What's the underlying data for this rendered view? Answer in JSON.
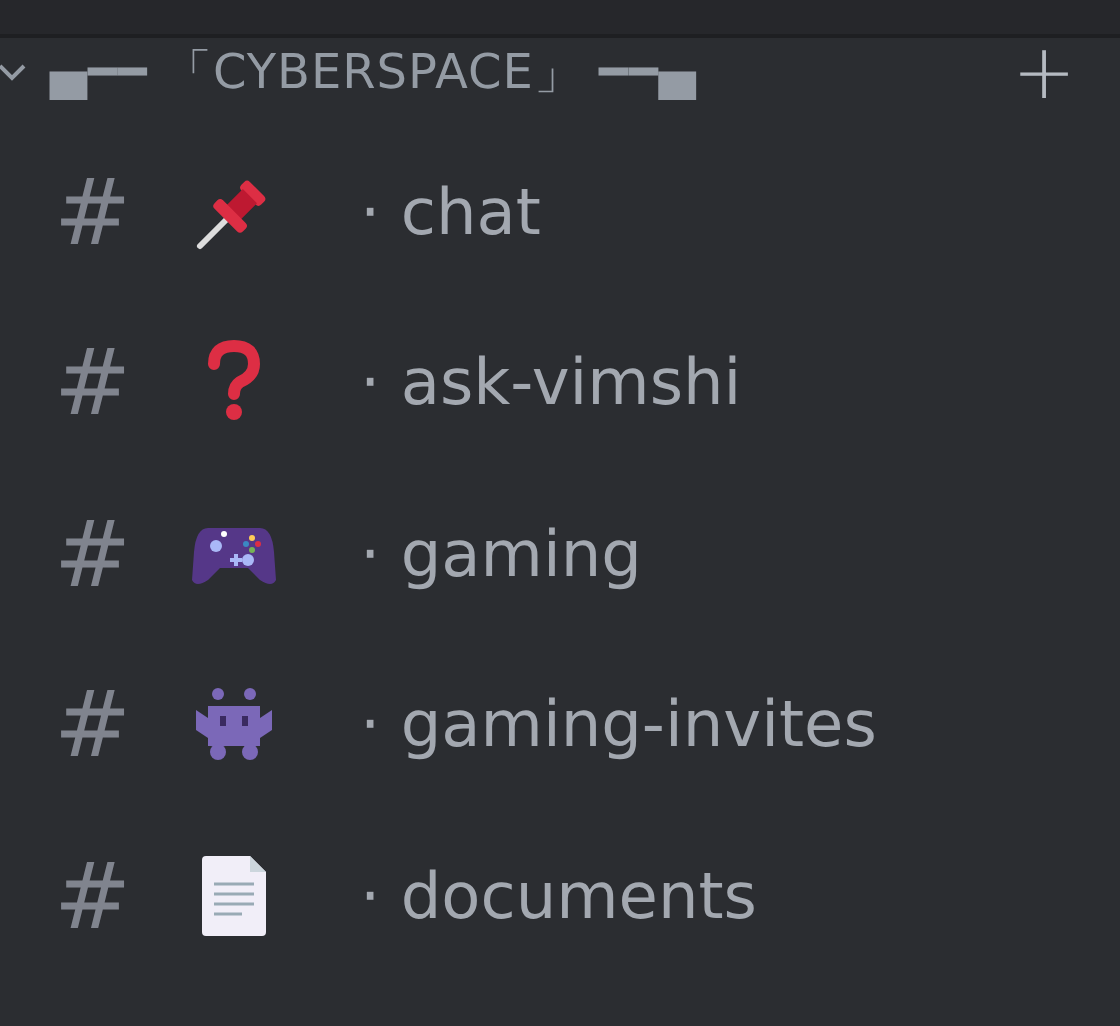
{
  "category": {
    "expanded": true,
    "name": "▄━━ 「CYBERSPACE」 ━━▄",
    "add_button": "+"
  },
  "channels": [
    {
      "hash": "#",
      "kind": "pin",
      "name": "· chat"
    },
    {
      "hash": "#",
      "kind": "question",
      "name": "· ask-vimshi"
    },
    {
      "hash": "#",
      "kind": "gamepad",
      "name": "· gaming"
    },
    {
      "hash": "#",
      "kind": "alien",
      "name": "· gaming-invites"
    },
    {
      "hash": "#",
      "kind": "document",
      "name": "· documents"
    }
  ]
}
